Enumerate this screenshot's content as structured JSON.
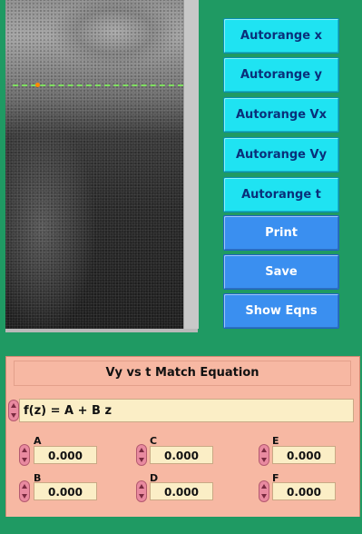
{
  "buttons": {
    "autorange_x": "Autorange x",
    "autorange_y": "Autorange y",
    "autorange_vx": "Autorange Vx",
    "autorange_vy": "Autorange Vy",
    "autorange_t": "Autorange t",
    "print": "Print",
    "save": "Save",
    "show_eqns": "Show Eqns"
  },
  "equation": {
    "title": "Vy vs t Match Equation",
    "formula": "f(z) = A + B z",
    "params": [
      {
        "label": "A",
        "value": "0.000"
      },
      {
        "label": "C",
        "value": "0.000"
      },
      {
        "label": "E",
        "value": "0.000"
      },
      {
        "label": "B",
        "value": "0.000"
      },
      {
        "label": "D",
        "value": "0.000"
      },
      {
        "label": "F",
        "value": "0.000"
      }
    ]
  },
  "colors": {
    "background": "#1f9a63",
    "cyan_button": "#1fe3f2",
    "blue_button": "#3a8ff0",
    "panel": "#f7b8a3",
    "field": "#fbeec6",
    "track_line": "#7fe060",
    "track_point": "#ff8a00"
  }
}
